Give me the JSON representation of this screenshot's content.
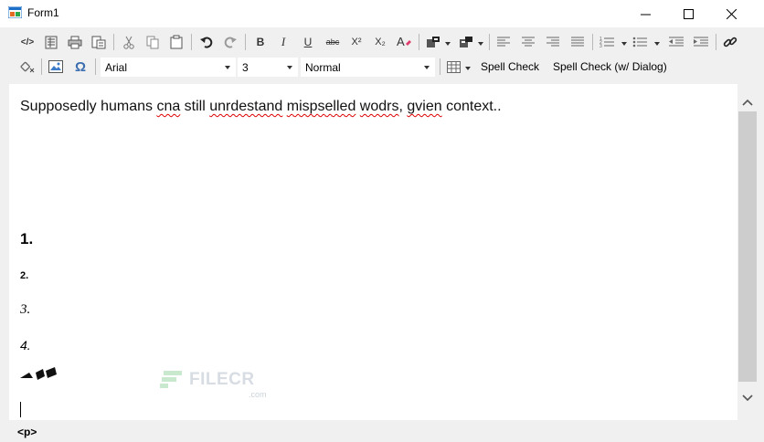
{
  "window": {
    "title": "Form1",
    "controls": [
      "minimize",
      "maximize",
      "close"
    ]
  },
  "toolbar1": {
    "items": [
      "source-view",
      "document-properties",
      "print",
      "paste-from-word",
      "cut",
      "copy",
      "paste",
      "undo",
      "redo",
      "bold",
      "italic",
      "underline",
      "strikethrough",
      "superscript",
      "subscript",
      "font-color",
      "insert-table-menu",
      "cell-menu",
      "align-left",
      "align-center",
      "align-right",
      "justify",
      "numbered-list",
      "bulleted-list",
      "outdent",
      "indent",
      "hyperlink"
    ],
    "bold_label": "B",
    "italic_label": "I",
    "underline_label": "U",
    "strike_label": "abc",
    "superscript_label": "X²",
    "subscript_label": "X₂",
    "source_label": "</>"
  },
  "toolbar2": {
    "font_family": "Arial",
    "font_size": "3",
    "paragraph_style": "Normal",
    "spell_check_label": "Spell Check",
    "spell_check_dialog_label": "Spell Check (w/ Dialog)"
  },
  "editor": {
    "sentence": {
      "w1": "Supposedly humans ",
      "w2": "cna",
      "w3": " still ",
      "w4": "unrdestand",
      "w5": " ",
      "w6": "mispselled",
      "w7": " ",
      "w8": "wodrs",
      "w9": ", ",
      "w10": "gvien",
      "w11": " context.."
    },
    "heading1": "1.",
    "heading2": "2.",
    "heading3": "3.",
    "heading4": "4."
  },
  "watermark": {
    "text": "FILECR",
    "sub": ".com"
  },
  "status_bar": {
    "current_tag": "<p>"
  },
  "colors": {
    "misspelling": "#d00000",
    "toolbar_bg": "#f0f0f0",
    "scroll_thumb": "#cdcdcd"
  }
}
